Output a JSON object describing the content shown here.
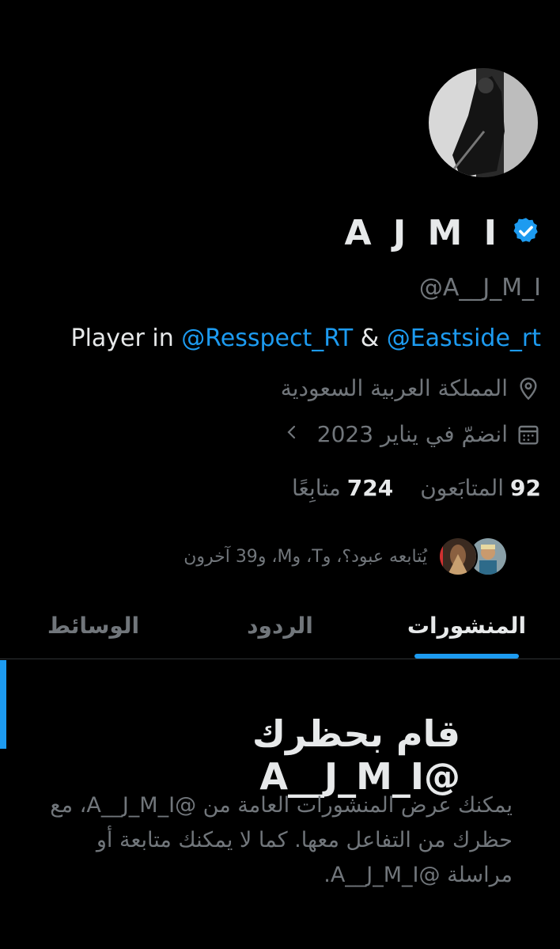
{
  "profile": {
    "display_name": "A J M I",
    "handle": "@A__J_M_I",
    "bio": {
      "prefix": "Player in ",
      "mention1": "@Resspect_RT",
      "joiner": " & ",
      "mention2": "@Eastside_rt"
    },
    "location": "المملكة العربية السعودية",
    "joined": "انضمّ في يناير 2023",
    "followers_count": "92",
    "followers_label": "المتابَعون",
    "following_count": "724",
    "following_label": "متابِعًا",
    "followed_by": "يُتابعه عبود؟، وT، وM، و39 آخرون"
  },
  "icons": {
    "verified": "verified-badge-icon",
    "location": "location-pin-icon",
    "calendar": "calendar-icon",
    "chevron": "chevron-left-icon"
  },
  "tabs": [
    {
      "label": "المنشورات",
      "active": true
    },
    {
      "label": "الردود",
      "active": false
    },
    {
      "label": "الوسائط",
      "active": false
    }
  ],
  "blocked": {
    "title": "قام بحظرك @A__J_M_I",
    "body": "يمكنك عرض المنشورات العامة من @A__J_M_I، مع حظرك من التفاعل معها. كما لا يمكنك متابعة أو مراسلة @A__J_M_I."
  },
  "colors": {
    "accent": "#1d9bf0",
    "background": "#000000",
    "text": "#e7e9ea",
    "muted": "#71767b"
  }
}
